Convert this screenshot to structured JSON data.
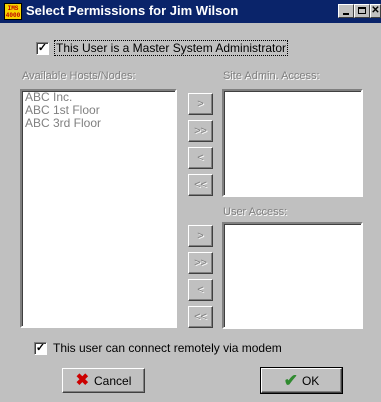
{
  "window": {
    "title": "Select Permissions for Jim Wilson",
    "app_icon_text": [
      "IMS",
      "4000"
    ],
    "controls": {
      "minimize": "minimize-icon",
      "maximize": "maximize-icon",
      "close": "close-icon"
    }
  },
  "master_admin": {
    "label": "This User is a Master System Administrator",
    "checked": true
  },
  "available": {
    "label": "Available Hosts/Nodes:",
    "items": [
      "ABC Inc.",
      "ABC 1st Floor",
      "ABC 3rd Floor"
    ]
  },
  "site_admin": {
    "label": "Site Admin. Access:",
    "items": []
  },
  "user_access": {
    "label": "User Access:",
    "items": []
  },
  "site_buttons": {
    "add": ">",
    "add_all": ">>",
    "remove": "<",
    "remove_all": "<<"
  },
  "user_buttons": {
    "add": ">",
    "add_all": ">>",
    "remove": "<",
    "remove_all": "<<"
  },
  "modem": {
    "label": "This user can connect remotely via modem",
    "checked": true
  },
  "buttons": {
    "cancel": "Cancel",
    "ok": "OK"
  }
}
